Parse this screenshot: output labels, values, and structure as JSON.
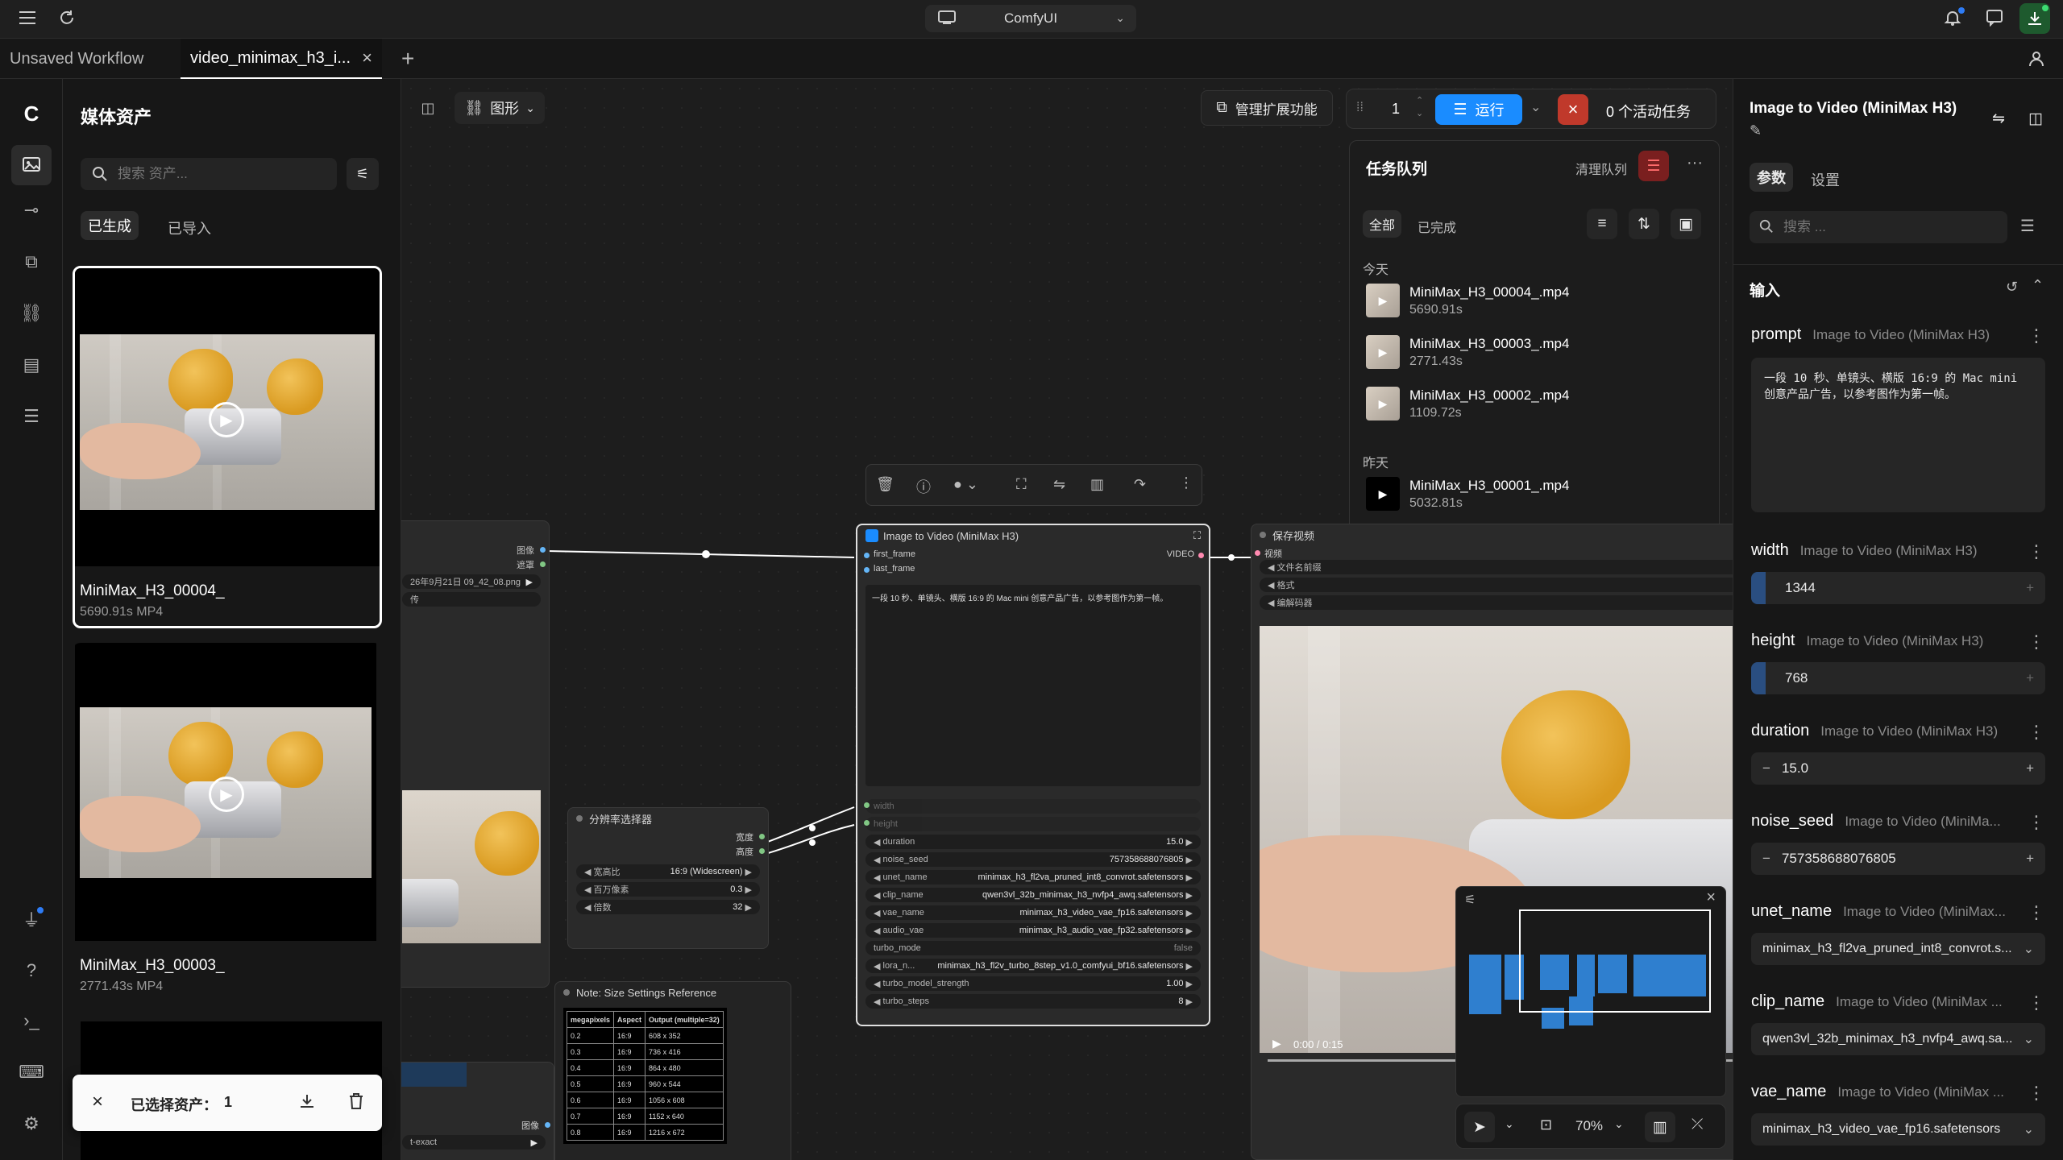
{
  "topbar": {
    "app_selector": "ComfyUI"
  },
  "tabs": [
    {
      "label": "Unsaved Workflow"
    },
    {
      "label": "video_minimax_h3_i..."
    }
  ],
  "assets_panel": {
    "title": "媒体资产",
    "search_placeholder": "搜索 资产...",
    "tabs": [
      "已生成",
      "已导入"
    ],
    "items": [
      {
        "name": "MiniMax_H3_00004_",
        "meta": "5690.91s  MP4"
      },
      {
        "name": "MiniMax_H3_00003_",
        "meta": "2771.43s  MP4"
      }
    ],
    "selection_bar": {
      "label": "已选择资产：",
      "count": "1"
    }
  },
  "canvas_toolbar": {
    "graph_mode": "图形",
    "manage_extensions": "管理扩展功能",
    "queue_count": "1",
    "run_label": "运行",
    "active_tasks": "0 个活动任务"
  },
  "queue_panel": {
    "title": "任务队列",
    "clear_label": "清理队列",
    "filters": [
      "全部",
      "已完成"
    ],
    "groups": [
      {
        "label": "今天",
        "items": [
          {
            "name": "MiniMax_H3_00004_.mp4",
            "time": "5690.91s"
          },
          {
            "name": "MiniMax_H3_00003_.mp4",
            "time": "2771.43s"
          },
          {
            "name": "MiniMax_H3_00002_.mp4",
            "time": "1109.72s"
          }
        ]
      },
      {
        "label": "昨天",
        "items": [
          {
            "name": "MiniMax_H3_00001_.mp4",
            "time": "5032.81s"
          }
        ]
      }
    ]
  },
  "main_node": {
    "title": "Image to Video (MiniMax H3)",
    "inputs": [
      "first_frame",
      "last_frame"
    ],
    "output": "VIDEO",
    "prompt": "一段 10 秒、单镜头、横版 16:9 的 Mac mini 创意产品广告，以参考图作为第一帧。",
    "widgets": [
      {
        "name": "width",
        "value": ""
      },
      {
        "name": "height",
        "value": ""
      },
      {
        "name": "duration",
        "value": "15.0"
      },
      {
        "name": "noise_seed",
        "value": "757358688076805"
      },
      {
        "name": "unet_name",
        "value": "minimax_h3_fl2va_pruned_int8_convrot.safetensors"
      },
      {
        "name": "clip_name",
        "value": "qwen3vl_32b_minimax_h3_nvfp4_awq.safetensors"
      },
      {
        "name": "vae_name",
        "value": "minimax_h3_video_vae_fp16.safetensors"
      },
      {
        "name": "audio_vae",
        "value": "minimax_h3_audio_vae_fp32.safetensors"
      },
      {
        "name": "turbo_mode",
        "value": "false"
      },
      {
        "name": "lora_n...",
        "value": "minimax_h3_fl2v_turbo_8step_v1.0_comfyui_bf16.safetensors"
      },
      {
        "name": "turbo_model_strength",
        "value": "1.00"
      },
      {
        "name": "turbo_steps",
        "value": "8"
      }
    ]
  },
  "left_node": {
    "outputs": [
      "图像",
      "遮罩"
    ],
    "filename": "26年9月21日 09_42_08.png",
    "upload": "传"
  },
  "resolution_node": {
    "title": "分辨率选择器",
    "outputs": [
      "宽度",
      "高度"
    ],
    "widgets": [
      {
        "name": "宽高比",
        "value": "16:9 (Widescreen)"
      },
      {
        "name": "百万像素",
        "value": "0.3"
      },
      {
        "name": "倍数",
        "value": "32"
      }
    ]
  },
  "note_node": {
    "title": "Note: Size Settings Reference",
    "header": [
      "megapixels",
      "Aspect",
      "Output (multiple=32)"
    ],
    "rows": [
      [
        "0.2",
        "16:9",
        "608 x 352"
      ],
      [
        "0.3",
        "16:9",
        "736 x 416"
      ],
      [
        "0.4",
        "16:9",
        "864 x 480"
      ],
      [
        "0.5",
        "16:9",
        "960 x 544"
      ],
      [
        "0.6",
        "16:9",
        "1056 x 608"
      ],
      [
        "0.7",
        "16:9",
        "1152 x 640"
      ],
      [
        "0.8",
        "16:9",
        "1216 x 672"
      ]
    ]
  },
  "save_node": {
    "title": "保存视频",
    "input": "视频",
    "widgets": [
      "文件名前缀",
      "格式",
      "编解码器"
    ],
    "video_time": "0:00 / 0:15"
  },
  "bottom_left_node": {
    "output": "图像",
    "widget": "t-exact"
  },
  "canvas_controls": {
    "zoom": "70%"
  },
  "right_panel": {
    "title": "Image to Video (MiniMax H3)",
    "tabs": [
      "参数",
      "设置"
    ],
    "search_placeholder": "搜索 ...",
    "section": "输入",
    "params": [
      {
        "name": "prompt",
        "source": "Image to Video (MiniMax H3)",
        "value": "一段 10 秒、单镜头、横版 16:9 的 Mac mini 创意产品广告，以参考图作为第一帧。"
      },
      {
        "name": "width",
        "source": "Image to Video (MiniMax H3)",
        "value": "1344"
      },
      {
        "name": "height",
        "source": "Image to Video (MiniMax H3)",
        "value": "768"
      },
      {
        "name": "duration",
        "source": "Image to Video (MiniMax H3)",
        "value": "15.0"
      },
      {
        "name": "noise_seed",
        "source": "Image to Video (MiniMa...",
        "value": "757358688076805"
      },
      {
        "name": "unet_name",
        "source": "Image to Video (MiniMax...",
        "value": "minimax_h3_fl2va_pruned_int8_convrot.s..."
      },
      {
        "name": "clip_name",
        "source": "Image to Video (MiniMax ...",
        "value": "qwen3vl_32b_minimax_h3_nvfp4_awq.sa..."
      },
      {
        "name": "vae_name",
        "source": "Image to Video (MiniMax ...",
        "value": "minimax_h3_video_vae_fp16.safetensors"
      }
    ]
  },
  "colors": {
    "accent": "#1a8cff",
    "danger": "#c0392b",
    "node_bg": "#2a2a2a",
    "minimap_nodes": "#2f7fcf"
  }
}
